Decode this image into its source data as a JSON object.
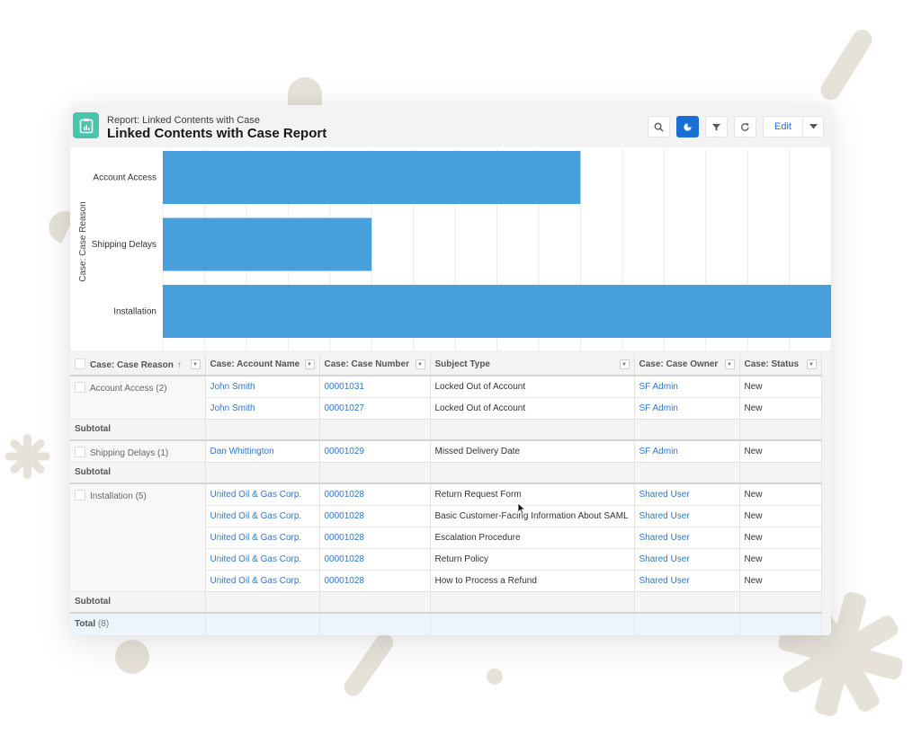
{
  "header": {
    "breadcrumb": "Report: Linked Contents with Case",
    "title": "Linked Contents with Case Report",
    "icon": "report-clipboard-icon"
  },
  "toolbar": {
    "buttons": [
      {
        "name": "search",
        "icon": "search-icon",
        "active": false
      },
      {
        "name": "chart",
        "icon": "pie-chart-icon",
        "active": true
      },
      {
        "name": "filter",
        "icon": "filter-icon",
        "active": false
      },
      {
        "name": "refresh",
        "icon": "refresh-icon",
        "active": false
      }
    ],
    "edit_label": "Edit",
    "edit_menu_icon": "chevron-down-icon"
  },
  "colors": {
    "bar": "#479fdb",
    "accent": "#1b6fd4",
    "link": "#2e78c7",
    "report_icon_bg": "#4bc4ae"
  },
  "chart_data": {
    "type": "bar",
    "orientation": "horizontal",
    "ylabel": "Case: Case Reason",
    "xlabel": "",
    "categories": [
      "Account Access",
      "Shipping Delays",
      "Installation"
    ],
    "values": [
      2,
      1,
      5
    ],
    "xlim": [
      0,
      3.2
    ],
    "grid": true,
    "grid_step": 0.2,
    "note": "Installation bar extends beyond visible area"
  },
  "table": {
    "columns": [
      {
        "label": "Case: Case Reason",
        "sorted": "asc"
      },
      {
        "label": "Case: Account Name"
      },
      {
        "label": "Case: Case Number"
      },
      {
        "label": "Subject Type"
      },
      {
        "label": "Case: Case Owner"
      },
      {
        "label": "Case: Status"
      }
    ],
    "groups": [
      {
        "label": "Account Access (2)",
        "rows": [
          {
            "account": "John Smith",
            "case_number": "00001031",
            "subject": "Locked Out of Account",
            "owner": "SF Admin",
            "status": "New"
          },
          {
            "account": "John Smith",
            "case_number": "00001027",
            "subject": "Locked Out of Account",
            "owner": "SF Admin",
            "status": "New"
          }
        ],
        "subtotal_label": "Subtotal"
      },
      {
        "label": "Shipping Delays (1)",
        "rows": [
          {
            "account": "Dan Whittington",
            "case_number": "00001029",
            "subject": "Missed Delivery Date",
            "owner": "SF Admin",
            "status": "New"
          }
        ],
        "subtotal_label": "Subtotal"
      },
      {
        "label": "Installation (5)",
        "rows": [
          {
            "account": "United Oil & Gas Corp.",
            "case_number": "00001028",
            "subject": "Return Request Form",
            "owner": "Shared User",
            "status": "New"
          },
          {
            "account": "United Oil & Gas Corp.",
            "case_number": "00001028",
            "subject": "Basic Customer-Facing Information About SAML",
            "owner": "Shared User",
            "status": "New"
          },
          {
            "account": "United Oil & Gas Corp.",
            "case_number": "00001028",
            "subject": "Escalation Procedure",
            "owner": "Shared User",
            "status": "New"
          },
          {
            "account": "United Oil & Gas Corp.",
            "case_number": "00001028",
            "subject": "Return Policy",
            "owner": "Shared User",
            "status": "New"
          },
          {
            "account": "United Oil & Gas Corp.",
            "case_number": "00001028",
            "subject": "How to Process a Refund",
            "owner": "Shared User",
            "status": "New"
          }
        ],
        "subtotal_label": "Subtotal"
      }
    ],
    "total_label": "Total",
    "total_count": "(8)"
  }
}
